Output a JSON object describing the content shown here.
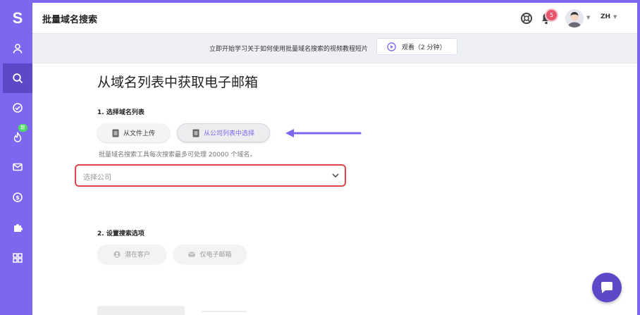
{
  "app": {
    "logo_letter": "S",
    "accent_color": "#7b68ee",
    "new_badge": "新"
  },
  "sidebar": {
    "items": [
      {
        "icon": "user-icon"
      },
      {
        "icon": "search-icon",
        "active": true
      },
      {
        "icon": "check-circle-icon"
      },
      {
        "icon": "fire-icon"
      },
      {
        "icon": "mail-icon"
      },
      {
        "icon": "dollar-icon"
      },
      {
        "icon": "puzzle-icon"
      },
      {
        "icon": "grid-icon"
      }
    ]
  },
  "header": {
    "title": "批量域名搜索",
    "notification_count": "5",
    "language": "ZH"
  },
  "banner": {
    "text": "立即开始学习关于如何使用批量域名搜索的视频教程短片",
    "watch_label": "观看（2 分钟）"
  },
  "main": {
    "title": "从域名列表中获取电子邮箱",
    "step1": {
      "label": "1. 选择域名列表",
      "option_upload": "从文件上传",
      "option_company": "从公司列表中选择",
      "hint": "批量域名搜索工具每次搜索最多可处理 20000 个域名。",
      "select_placeholder": "选择公司"
    },
    "step2": {
      "label": "2. 设置搜索选项",
      "option_leads": "潜在客户",
      "option_emails": "仅电子邮箱"
    }
  }
}
